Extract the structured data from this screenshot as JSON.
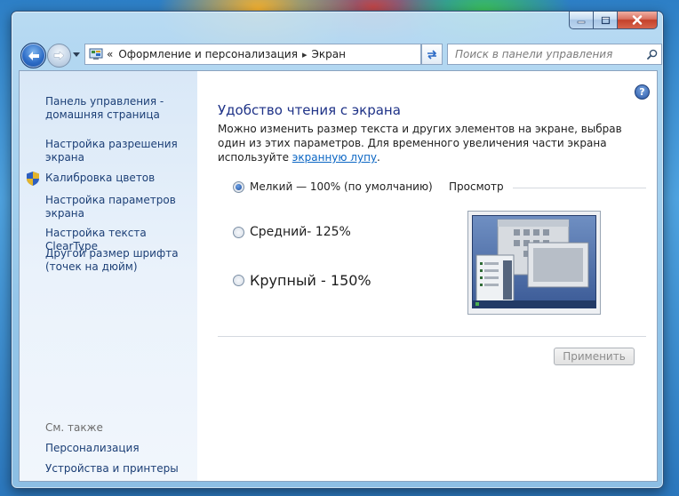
{
  "window": {
    "caption_buttons": {
      "minimize": "minimize-icon",
      "maximize": "maximize-icon",
      "close": "close-icon"
    }
  },
  "nav": {
    "back_icon": "arrow-left-icon",
    "forward_icon": "arrow-right-icon",
    "address_prefix": "«",
    "breadcrumbs": [
      "Оформление и персонализация",
      "Экран"
    ],
    "crumb_separator": "▸",
    "search_placeholder": "Поиск в панели управления"
  },
  "sidebar": {
    "links": [
      "Панель управления - домашняя страница",
      "Настройка разрешения экрана",
      "Калибровка цветов",
      "Настройка параметров экрана",
      "Настройка текста ClearType",
      "Другой размер шрифта (точек на дюйм)"
    ],
    "see_also_label": "См. также",
    "see_also_links": [
      "Персонализация",
      "Устройства и принтеры"
    ]
  },
  "main": {
    "help_label": "?",
    "title": "Удобство чтения с экрана",
    "intro_text": "Можно изменить размер текста и других элементов на экране, выбрав один из этих параметров. Для временного увеличения части экрана используйте ",
    "intro_link": "экранную лупу",
    "intro_end": ".",
    "options": [
      {
        "label": "Мелкий — 100% (по умолчанию)",
        "checked": true
      },
      {
        "label": "Средний- 125%",
        "checked": false
      },
      {
        "label": "Крупный - 150%",
        "checked": false
      }
    ],
    "preview_label": "Просмотр",
    "apply_label": "Применить"
  },
  "colors": {
    "title": "#1e3287",
    "link": "#1c3f76",
    "accent_link": "#0b66c4"
  }
}
